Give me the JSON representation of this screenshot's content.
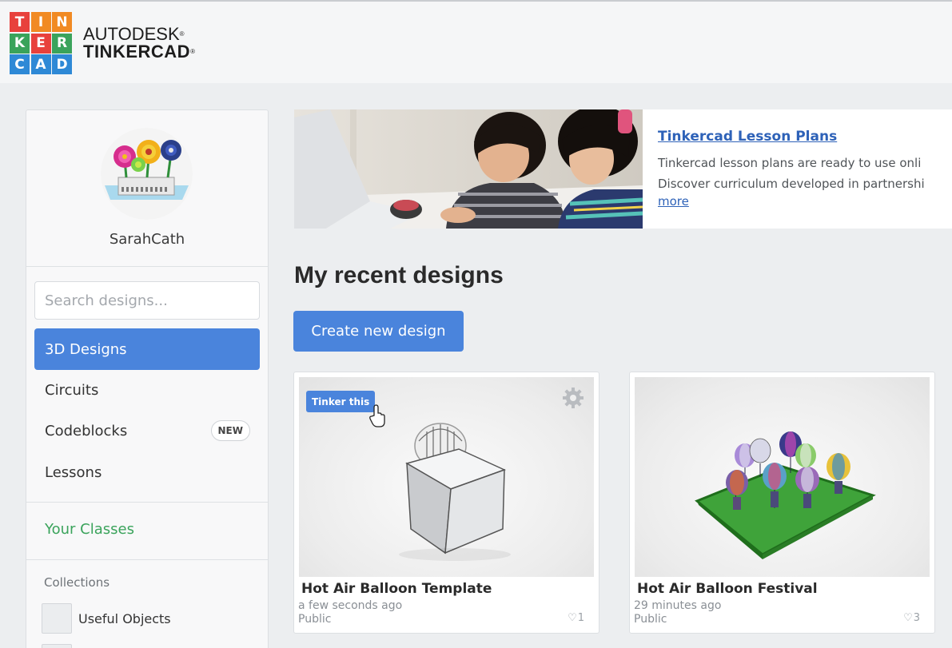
{
  "header": {
    "logo_letters": [
      "T",
      "I",
      "N",
      "K",
      "E",
      "R",
      "C",
      "A",
      "D"
    ],
    "logo_colors": [
      "#e8413c",
      "#f18a23",
      "#f18a23",
      "#3aa35b",
      "#e8413c",
      "#3aa35b",
      "#2e89d6",
      "#2e89d6",
      "#2e89d6"
    ],
    "brand_line1": "AUTODESK",
    "brand_line2": "TINKERCAD"
  },
  "sidebar": {
    "username": "SarahCath",
    "search_placeholder": "Search designs...",
    "nav": [
      {
        "label": "3D Designs",
        "active": true
      },
      {
        "label": "Circuits"
      },
      {
        "label": "Codeblocks",
        "badge": "NEW"
      },
      {
        "label": "Lessons"
      }
    ],
    "classes_label": "Your Classes",
    "collections_label": "Collections",
    "collection_items": [
      {
        "label": "Useful Objects"
      }
    ]
  },
  "banner": {
    "title": "Tinkercad Lesson Plans",
    "line1": "Tinkercad lesson plans are ready to use onli",
    "line2": "Discover curriculum developed in partnershi",
    "more": "more"
  },
  "main": {
    "section_title": "My recent designs",
    "create_button": "Create new design",
    "designs": [
      {
        "title": "Hot Air Balloon Template",
        "time": "a few seconds ago",
        "visibility": "Public",
        "likes": "1",
        "tinker_label": "Tinker this"
      },
      {
        "title": "Hot Air Balloon Festival",
        "time": "29 minutes ago",
        "visibility": "Public",
        "likes": "3"
      }
    ]
  },
  "colors": {
    "accent": "#4a84dc",
    "link": "#2e62b8",
    "classes": "#3aa35b"
  }
}
